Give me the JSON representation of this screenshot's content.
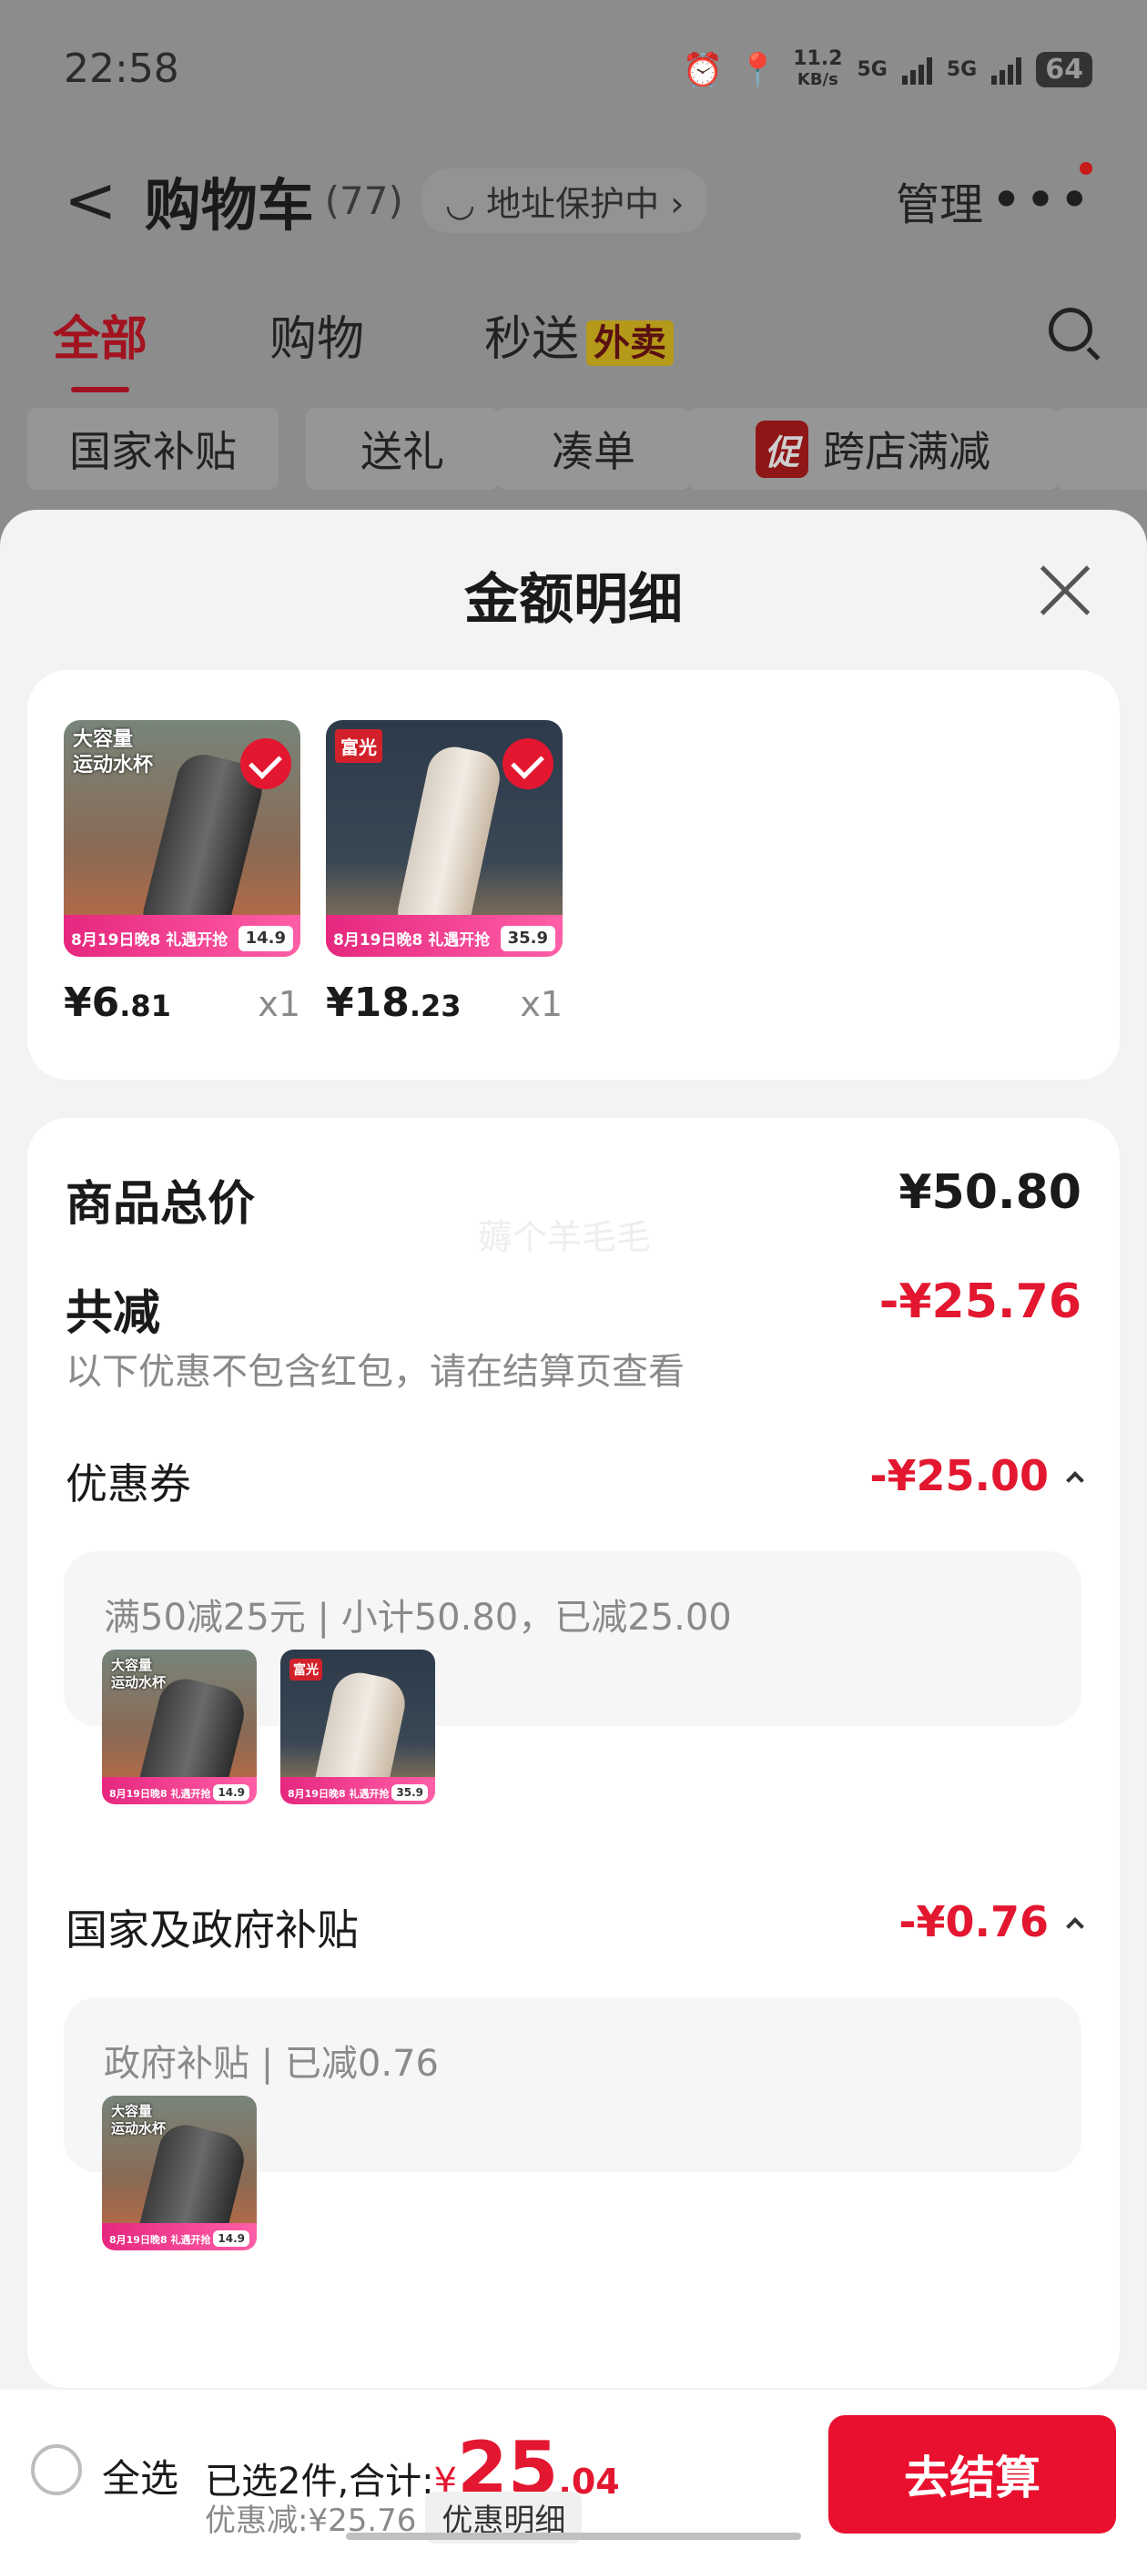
{
  "status_bar": {
    "time": "22:58",
    "net_speed": "11.2",
    "net_unit": "KB/s",
    "sig1": "5G",
    "sig2": "5G",
    "battery": "64"
  },
  "header": {
    "back": "<",
    "title": "购物车",
    "count": "(77)",
    "address_badge": "地址保护中",
    "manage": "管理",
    "more": "•••"
  },
  "tabs": [
    {
      "label": "全部"
    },
    {
      "label": "购物"
    },
    {
      "label": "秒送",
      "tag": "外卖"
    }
  ],
  "chips": [
    "国家补贴",
    "送礼",
    "凑单",
    "跨店满减"
  ],
  "promo_tag": "促",
  "sheet": {
    "title": "金额明细",
    "products": [
      {
        "title_lines": [
          "大容量",
          "运动水杯"
        ],
        "banner": "8月19日晚8 礼遇开抢",
        "banner_price": "14.9",
        "price_int": "¥6",
        "price_dec": ".81",
        "qty": "x1"
      },
      {
        "brand": "富光",
        "banner": "8月19日晚8 礼遇开抢",
        "banner_price": "35.9",
        "price_int": "¥18",
        "price_dec": ".23",
        "qty": "x1"
      }
    ],
    "total_label": "商品总价",
    "total_value": "¥50.80",
    "watermark": "薅个羊毛毛",
    "reduce_label": "共减",
    "reduce_value": "-¥25.76",
    "reduce_hint": "以下优惠不包含红包，请在结算页查看",
    "coupon": {
      "label": "优惠券",
      "value": "-¥25.00",
      "desc": "满50减25元 | 小计50.80，已减25.00"
    },
    "subsidy": {
      "label": "国家及政府补贴",
      "value": "-¥0.76",
      "desc": "政府补贴 | 已减0.76"
    }
  },
  "bottom": {
    "select_all": "全选",
    "selected_text": "已选2件,合计:",
    "yen": "¥",
    "total_int": "25",
    "total_dec": ".04",
    "discount_text": "优惠减:¥25.76",
    "detail_button": "优惠明细",
    "checkout": "去结算"
  }
}
